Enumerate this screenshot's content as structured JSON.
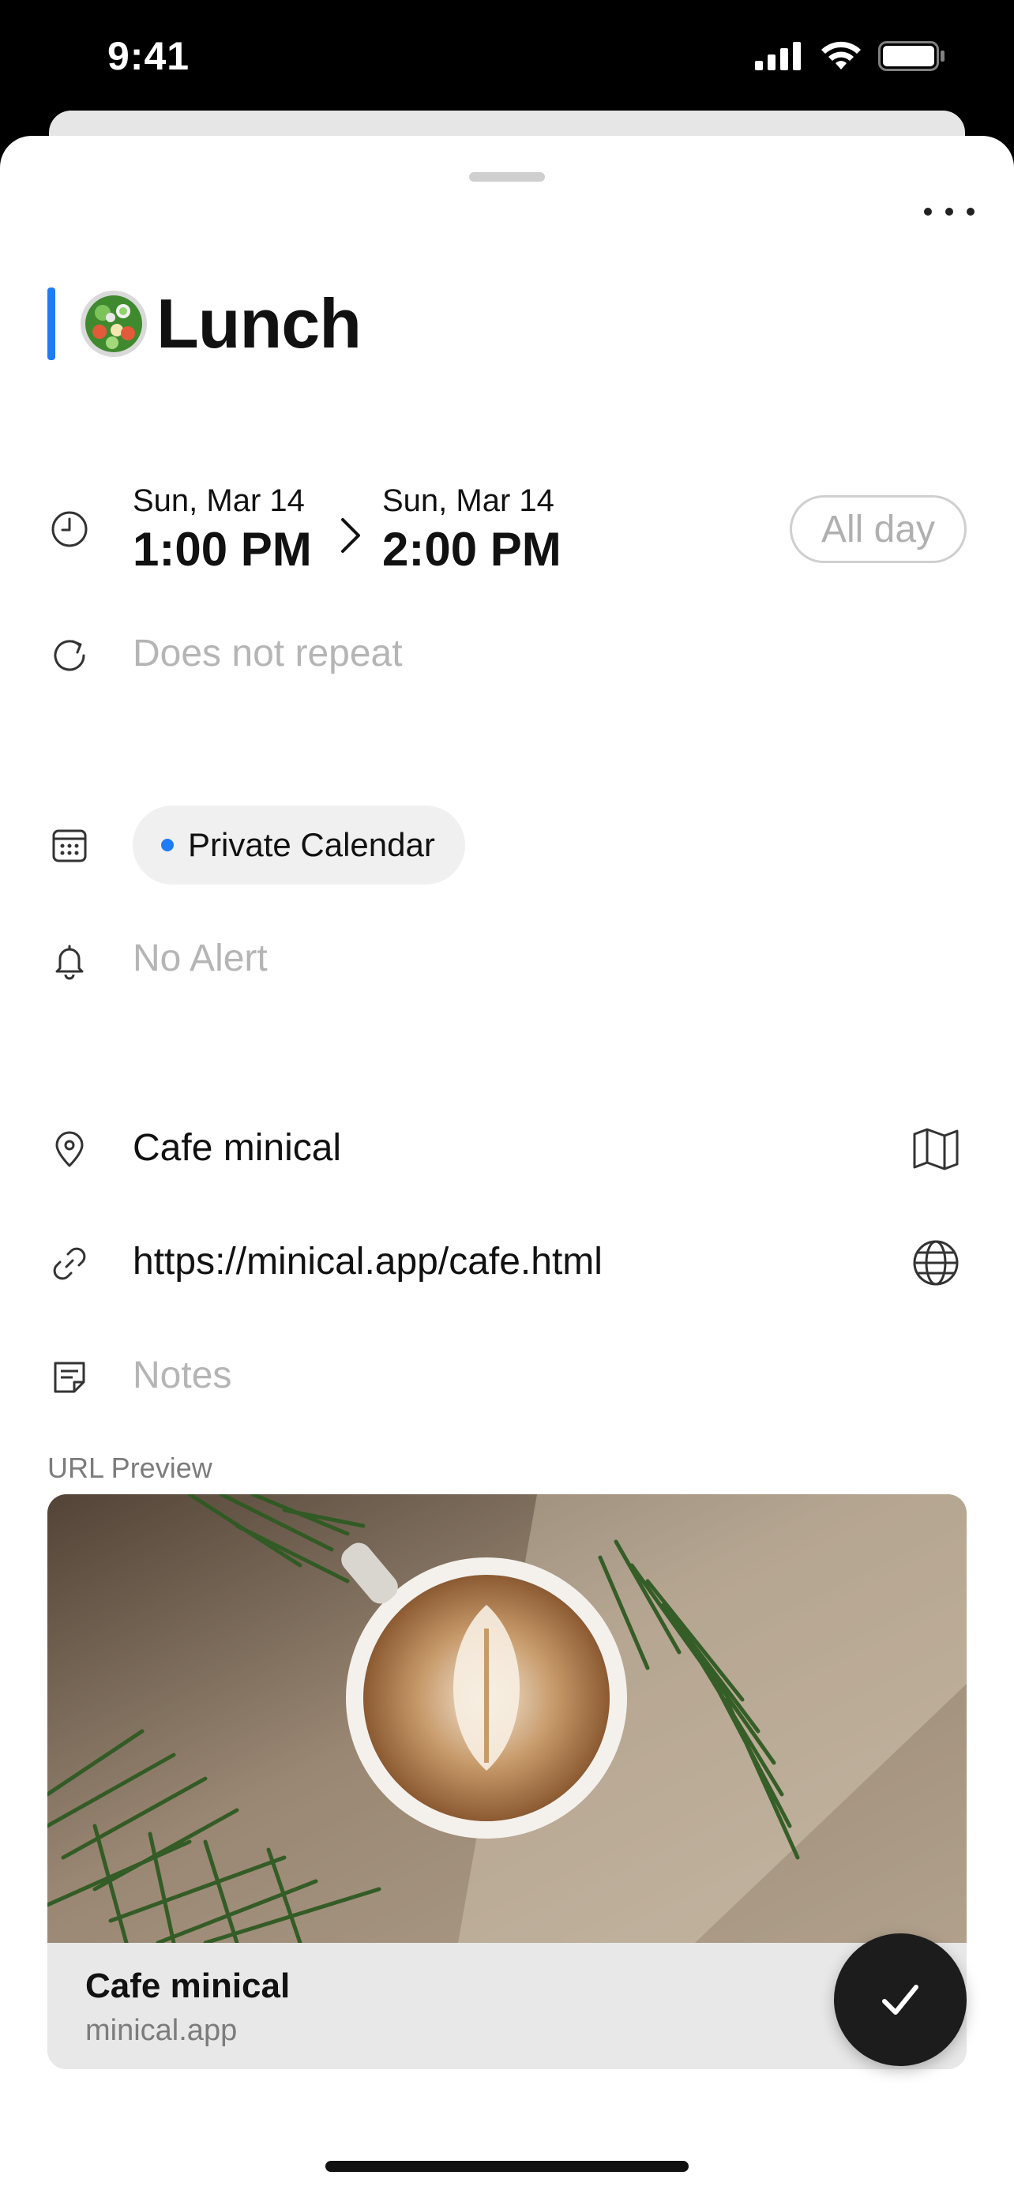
{
  "status_bar": {
    "time": "9:41"
  },
  "event": {
    "title": "Lunch",
    "accent_color": "#1f7cf7",
    "start": {
      "date": "Sun, Mar 14",
      "time": "1:00 PM"
    },
    "end": {
      "date": "Sun, Mar 14",
      "time": "2:00 PM"
    },
    "all_day_label": "All day",
    "repeat_placeholder": "Does not repeat",
    "calendar": {
      "name": "Private Calendar",
      "color": "#1f7cf7"
    },
    "alert_placeholder": "No Alert",
    "location": "Cafe minical",
    "url": "https://minical.app/cafe.html",
    "notes_placeholder": "Notes"
  },
  "url_preview": {
    "section_label": "URL Preview",
    "title": "Cafe minical",
    "domain": "minical.app"
  },
  "icons": {
    "more": "more-horizontal-icon",
    "time": "clock-icon",
    "repeat": "repeat-icon",
    "calendar": "calendar-icon",
    "alert": "bell-icon",
    "location": "location-pin-icon",
    "map": "map-icon",
    "link": "link-icon",
    "globe": "globe-icon",
    "notes": "notes-icon",
    "done": "checkmark-icon"
  }
}
